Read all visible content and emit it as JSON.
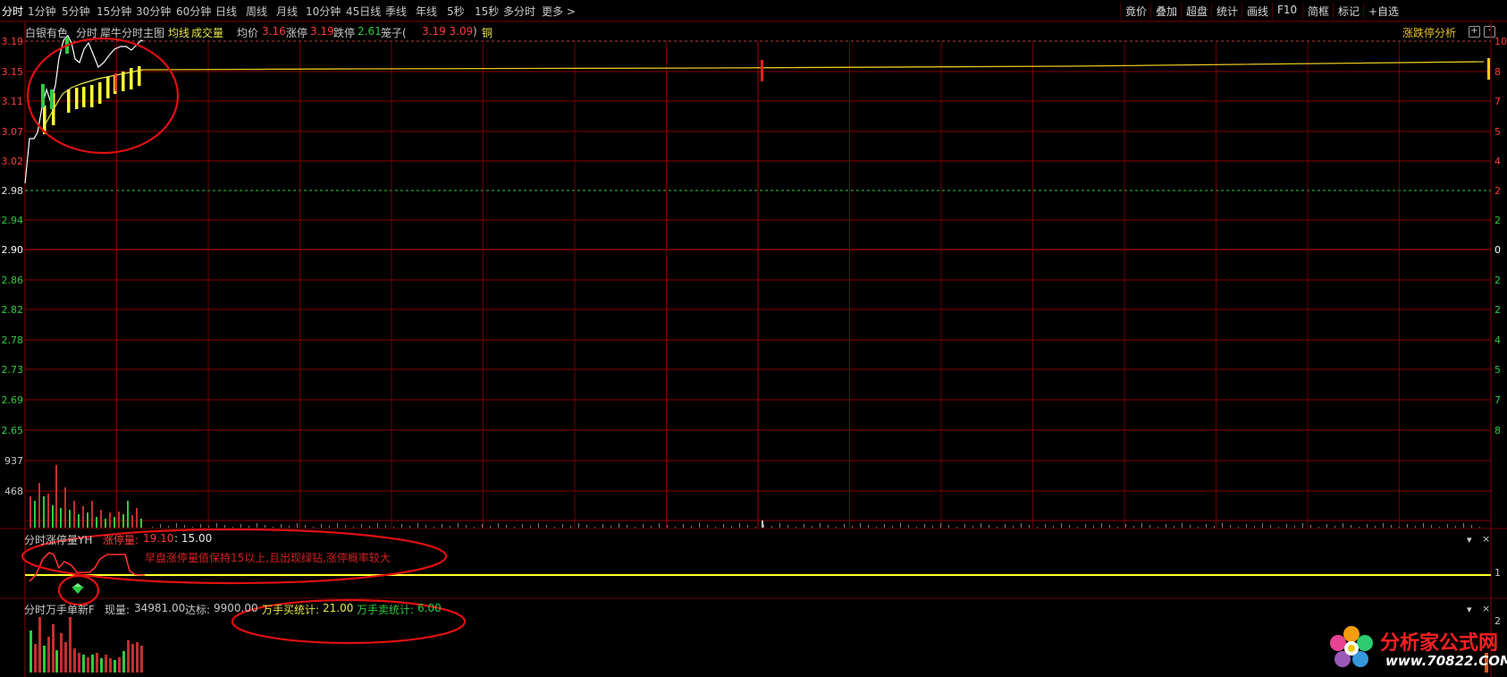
{
  "toolbar": {
    "tabs": [
      {
        "label": "分时",
        "active": true
      },
      {
        "label": "1分钟"
      },
      {
        "label": "5分钟"
      },
      {
        "label": "15分钟"
      },
      {
        "label": "30分钟"
      },
      {
        "label": "60分钟"
      },
      {
        "label": "日线"
      },
      {
        "label": "周线"
      },
      {
        "label": "月线"
      },
      {
        "label": "10分钟"
      },
      {
        "label": "45日线"
      },
      {
        "label": "季线"
      },
      {
        "label": "年线"
      },
      {
        "label": "5秒"
      },
      {
        "label": "15秒"
      },
      {
        "label": "多分时"
      },
      {
        "label": "更多 >"
      }
    ],
    "right_buttons": [
      "竟价",
      "叠加",
      "超盘",
      "统计",
      "画线",
      "F10",
      "简框",
      "标记",
      "+自选"
    ]
  },
  "info_line": {
    "stock_name": "白银有色",
    "mode": "分时",
    "indicator": "犀牛分时主图",
    "avg_line_label": "均线",
    "volume_label": "成交量",
    "avg_price_label": "均价",
    "avg_price_value": "3.16",
    "limit_up_label": "涨停",
    "limit_up_value": "3.19",
    "limit_down_label": "跌停",
    "limit_down_value": "2.61",
    "cage_label": "笼子(",
    "cage_values": "3.19 3.09",
    "cage_close": ")",
    "sector": "铜",
    "right_label": "涨跌停分析"
  },
  "price_axis": [
    "3.19",
    "3.15",
    "3.11",
    "3.07",
    "3.02",
    "2.98",
    "2.94",
    "2.90",
    "2.86",
    "2.82",
    "2.78",
    "2.73",
    "2.69",
    "2.65"
  ],
  "pct_axis": [
    "10",
    "8",
    "7",
    "5",
    "4",
    "2",
    "2",
    "0",
    "2",
    "2",
    "4",
    "5",
    "7",
    "8"
  ],
  "volume_axis": [
    "937",
    "468"
  ],
  "panel1": {
    "title": "分时涨停量YH",
    "field_label": "涨停量:",
    "field_value": "19.10",
    "field2": ": 15.00",
    "right_value": "1",
    "close": "×",
    "dropdown": "▾"
  },
  "panel2": {
    "title": "分时万手单新F",
    "now_label": "现量:",
    "now_value": "34981.00",
    "target_label": "达标:",
    "target_value": "9900.00",
    "buy_label": "万手买统计:",
    "buy_value": "21.00",
    "sell_label": "万手卖统计:",
    "sell_value": "6.00",
    "right_value": "2",
    "close": "×",
    "dropdown": "▾"
  },
  "annotation": "早盘涨停量值保持15以上,且出现绿钻,涨停概率较大",
  "logo": {
    "title": "分析家公式网",
    "url": "www.70822.COM"
  },
  "colors": {
    "grid": "#8a0000",
    "up": "#ff3b3b",
    "down": "#2ecc40",
    "price_line": "#ffffff",
    "avg_line": "#e8e84a",
    "annotation": "#d42020"
  }
}
